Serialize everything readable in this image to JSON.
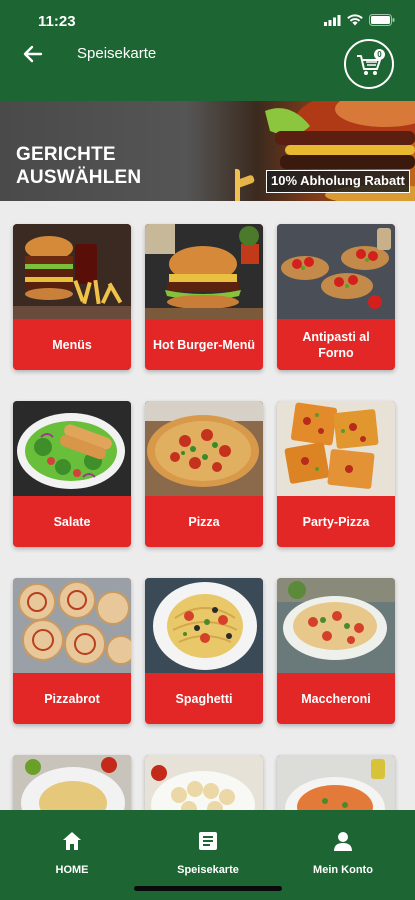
{
  "status_bar": {
    "time": "11:23"
  },
  "header": {
    "title": "Speisekarte",
    "cart_count": "0"
  },
  "banner": {
    "title_line1": "GERICHTE",
    "title_line2": "AUSWÄHLEN",
    "badge": "10% Abholung Rabatt"
  },
  "categories": [
    {
      "label": "Menüs",
      "image": "burger-menu-photo"
    },
    {
      "label": "Hot Burger-Menü",
      "image": "hot-burger-photo"
    },
    {
      "label": "Antipasti al Forno",
      "image": "antipasti-photo"
    },
    {
      "label": "Salate",
      "image": "salad-photo"
    },
    {
      "label": "Pizza",
      "image": "pizza-photo"
    },
    {
      "label": "Party-Pizza",
      "image": "party-pizza-photo"
    },
    {
      "label": "Pizzabrot",
      "image": "pizzabrot-photo"
    },
    {
      "label": "Spaghetti",
      "image": "spaghetti-photo"
    },
    {
      "label": "Maccheroni",
      "image": "maccheroni-photo"
    },
    {
      "label": "",
      "image": "pasta-photo"
    },
    {
      "label": "",
      "image": "tortellini-photo"
    },
    {
      "label": "",
      "image": "penne-photo"
    }
  ],
  "bottom_nav": {
    "items": [
      {
        "label": "HOME",
        "icon": "home-icon"
      },
      {
        "label": "Speisekarte",
        "icon": "menu-doc-icon"
      },
      {
        "label": "Mein Konto",
        "icon": "user-icon"
      }
    ]
  },
  "colors": {
    "primary_green": "#1d6532",
    "card_red": "#e32626",
    "background": "#ececec"
  }
}
